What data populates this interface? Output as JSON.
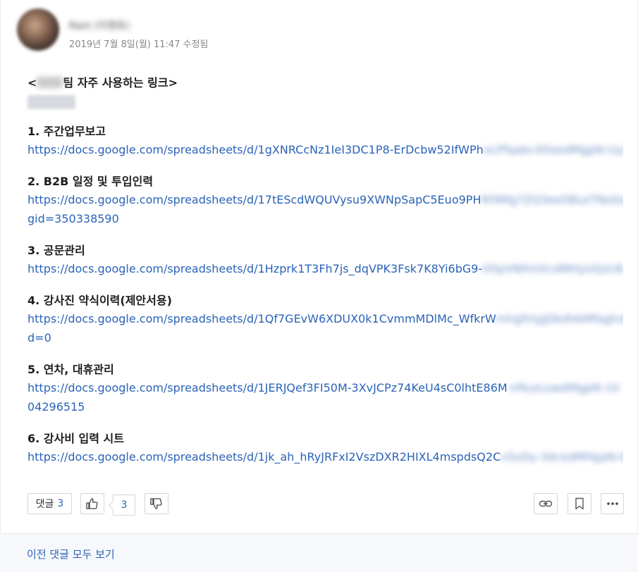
{
  "post": {
    "author": "Ram (이영호)",
    "date": "2019년 7월 8일(월) 11:47",
    "edited": "수정됨",
    "title_prefix": "<",
    "title_suffix": "팀 자주 사용하는 링크>",
    "items": [
      {
        "title": "1. 주간업무보고",
        "link_visible": "https://docs.google.com/spreadsheets/d/1gXNRCcNz1IeI3DC1P8-ErDcbw52IfWPh",
        "link_blurred": "oLPfqabcXDzedMgpN-Uyxb/edit",
        "link_line2": ""
      },
      {
        "title": "2. B2B 일정 및 투입인력",
        "link_visible": "https://docs.google.com/spreadsheets/d/17tEScdWQUVysu9XWNpSapC5Euo9PH",
        "link_blurred": "Rf4Mg7ZQ3ee5BLeTNzQs/edit#",
        "link_line2": "gid=350338590"
      },
      {
        "title": "3. 공문관리",
        "link_visible": "https://docs.google.com/spreadsheets/d/1Hzprk1T3Fh7js_dqVPK3Fsk7K8Yi6bG9-",
        "link_blurred": "H5pVNfmIXcdMHyUQzU6",
        "link_line2": ""
      },
      {
        "title": "4. 강사진 약식이력(제안서용)",
        "link_visible": "https://docs.google.com/spreadsheets/d/1Qf7GEvW6XDUX0k1CvmmMDlMc_WfkrW",
        "link_blurred": "mhgfmjgDkdVeMfagh/edit#gi",
        "link_line2": "d=0"
      },
      {
        "title": "5. 연차, 대휴관리",
        "link_visible": "https://docs.google.com/spreadsheets/d/1JERJQef3FI50M-3XvJCPz74KeU4sC0lhtE86M",
        "link_blurred": "-VRuzLowdMgpN-10",
        "link_line2": "04296515"
      },
      {
        "title": "6. 강사비 입력 시트",
        "link_visible": "https://docs.google.com/spreadsheets/d/1jk_ah_hRyJRFxI2VszDXR2HIXL4mspdsQ2C",
        "link_blurred": "vSxDy-3dcedMHgaN-0",
        "link_line2": ""
      }
    ]
  },
  "actions": {
    "comment_label": "댓글",
    "comment_count": "3",
    "like_count": "3",
    "icons": [
      "thumbs-up-icon",
      "thumbs-down-icon",
      "link-icon",
      "bookmark-icon",
      "more-icon"
    ]
  },
  "footer": {
    "view_all": "이전 댓글 모두 보기"
  },
  "colors": {
    "link": "#2b63b8",
    "text": "#1d1d1d",
    "muted": "#888888",
    "footer_bg": "#f6f8fb"
  }
}
